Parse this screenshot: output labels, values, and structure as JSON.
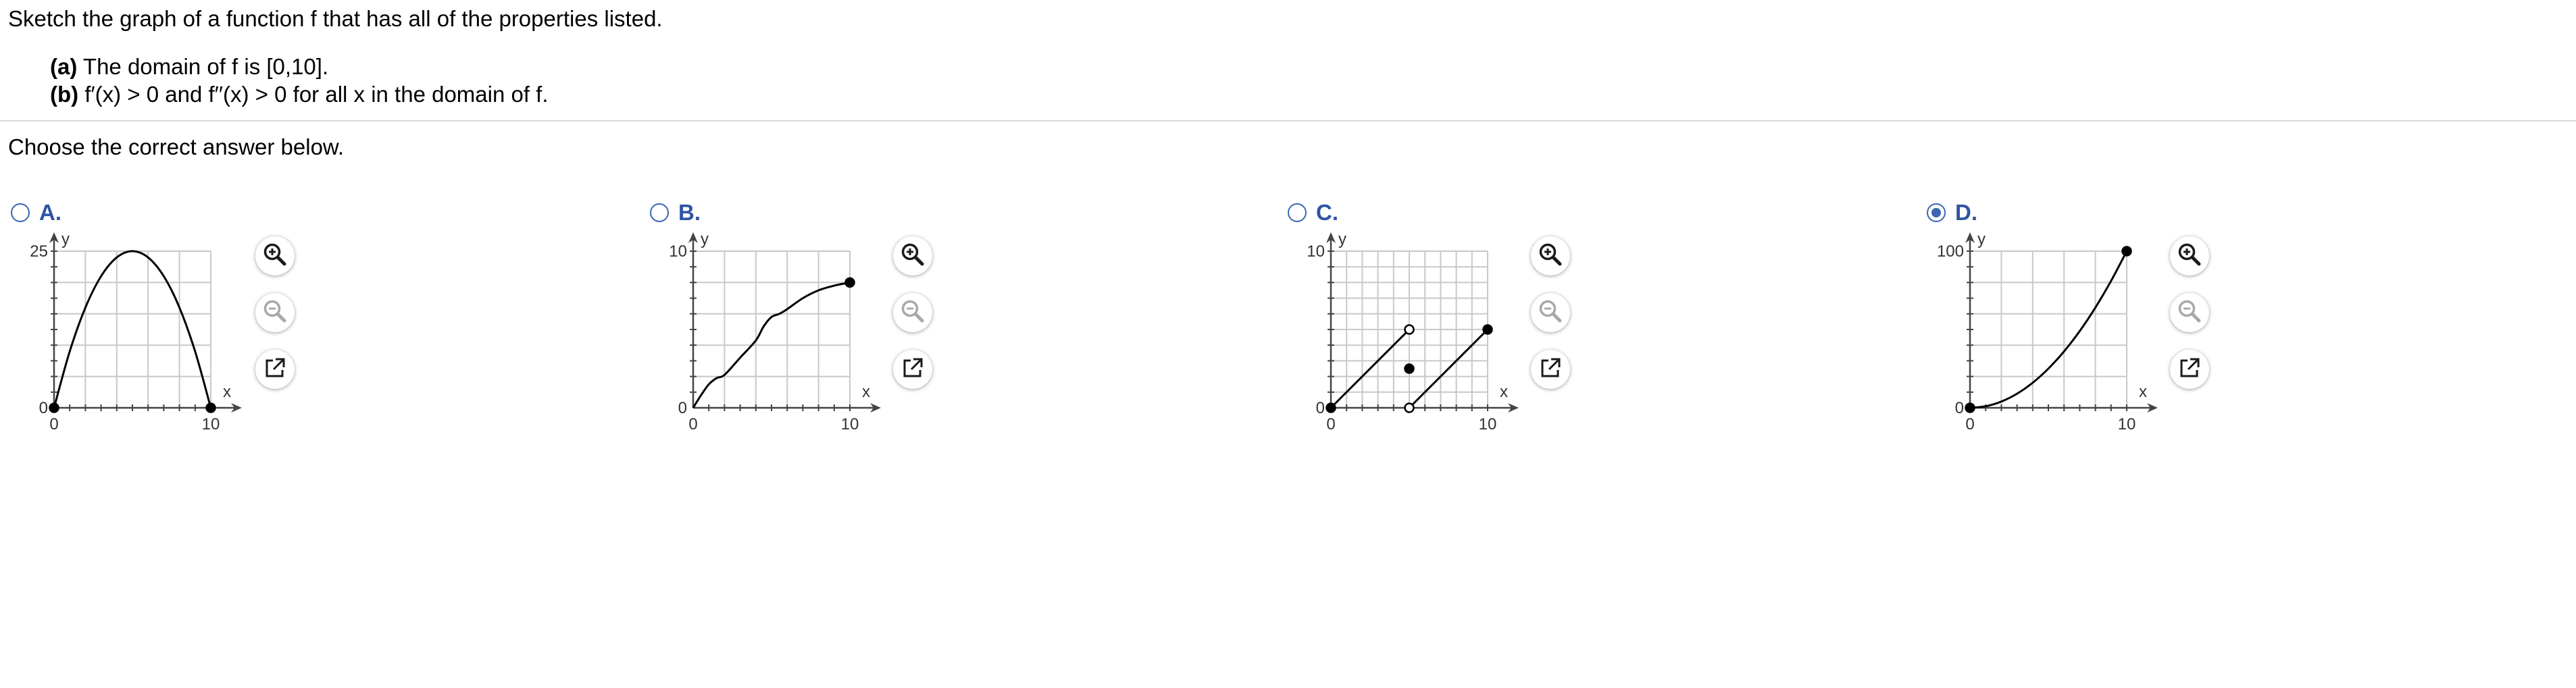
{
  "question": {
    "text": "Sketch the graph of a function f that has all of the properties listed.",
    "properties": [
      {
        "label": "(a)",
        "text": "The domain of f is [0,10]."
      },
      {
        "label": "(b)",
        "text": "f′(x) > 0 and f′′(x) > 0 for all x in the domain of f."
      }
    ]
  },
  "instruction": "Choose the correct answer below.",
  "choices": [
    {
      "letter": "A.",
      "selected": false,
      "y_max": 25,
      "x_tick": "10",
      "y_tick": "25",
      "origin_tick": "0",
      "x_axis_label": "x",
      "y_axis_label": "y"
    },
    {
      "letter": "B.",
      "selected": false,
      "y_max": 10,
      "x_tick": "10",
      "y_tick": "10",
      "origin_tick": "0",
      "x_axis_label": "x",
      "y_axis_label": "y"
    },
    {
      "letter": "C.",
      "selected": false,
      "y_max": 10,
      "x_tick": "10",
      "y_tick": "10",
      "origin_tick": "0",
      "x_axis_label": "x",
      "y_axis_label": "y"
    },
    {
      "letter": "D.",
      "selected": true,
      "y_max": 100,
      "x_tick": "10",
      "y_tick": "100",
      "origin_tick": "0",
      "x_axis_label": "x",
      "y_axis_label": "y"
    }
  ],
  "chart_data": [
    {
      "type": "line",
      "choice": "A",
      "xlim": [
        0,
        10
      ],
      "ylim": [
        0,
        25
      ],
      "grid": true,
      "x": [
        0,
        1,
        2,
        3,
        4,
        5,
        6,
        7,
        8,
        9,
        10
      ],
      "y": [
        0,
        9,
        16,
        21,
        24,
        25,
        24,
        21,
        16,
        9,
        0
      ],
      "endpoints": [
        {
          "x": 0,
          "y": 0,
          "filled": true
        },
        {
          "x": 10,
          "y": 0,
          "filled": true
        }
      ]
    },
    {
      "type": "line",
      "choice": "B",
      "xlim": [
        0,
        10
      ],
      "ylim": [
        0,
        10
      ],
      "grid": true,
      "x": [
        0,
        0.5,
        1,
        1.5,
        2,
        3,
        4,
        4.5,
        5,
        5.5,
        6,
        7,
        8,
        9,
        10
      ],
      "y": [
        0,
        0.8,
        1.5,
        1.9,
        2.1,
        3.2,
        4.3,
        5.2,
        5.8,
        6.0,
        6.3,
        7.0,
        7.5,
        7.8,
        8.0
      ],
      "endpoints": [
        {
          "x": 10,
          "y": 8,
          "filled": true
        }
      ]
    },
    {
      "type": "line",
      "choice": "C",
      "xlim": [
        0,
        10
      ],
      "ylim": [
        0,
        10
      ],
      "grid": true,
      "segments": [
        {
          "x": [
            0,
            5
          ],
          "y": [
            0,
            5
          ]
        },
        {
          "x": [
            5,
            10
          ],
          "y": [
            0,
            5
          ]
        }
      ],
      "points": [
        {
          "x": 0,
          "y": 0,
          "filled": true
        },
        {
          "x": 5,
          "y": 5,
          "filled": false
        },
        {
          "x": 5,
          "y": 2.5,
          "filled": true
        },
        {
          "x": 5,
          "y": 0,
          "filled": false
        },
        {
          "x": 10,
          "y": 5,
          "filled": true
        }
      ]
    },
    {
      "type": "line",
      "choice": "D",
      "xlim": [
        0,
        10
      ],
      "ylim": [
        0,
        100
      ],
      "grid": true,
      "x": [
        0,
        1,
        2,
        3,
        4,
        5,
        6,
        7,
        8,
        9,
        10
      ],
      "y": [
        0,
        1,
        4,
        9,
        16,
        25,
        36,
        49,
        64,
        81,
        100
      ],
      "endpoints": [
        {
          "x": 0,
          "y": 0,
          "filled": true
        },
        {
          "x": 10,
          "y": 100,
          "filled": true
        }
      ]
    }
  ],
  "tool_icons": [
    "zoom-in-icon",
    "zoom-out-icon",
    "open-external-icon"
  ],
  "colors": {
    "accent": "#3a66b4",
    "letter": "#2e55a3",
    "grid": "#c8c8c8",
    "curve": "#000000"
  }
}
